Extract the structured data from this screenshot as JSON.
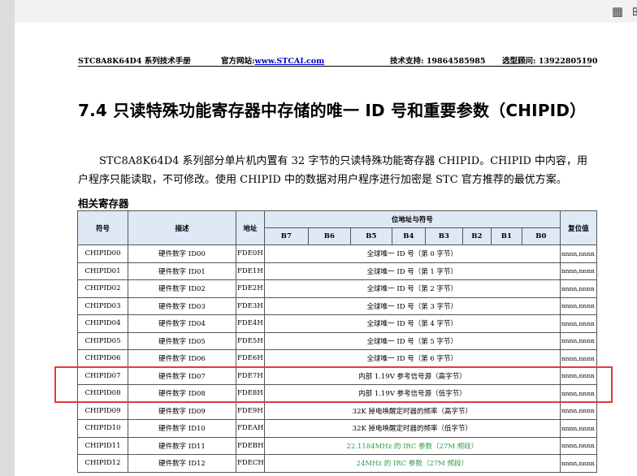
{
  "header": {
    "doc_name": "STC8A8K64D4 系列技术手册",
    "site_label": "官方网站:",
    "site_url": "www.STCAI.com",
    "support": "技术支持: 19864585985",
    "advisor": "选型顾问: 13922805190"
  },
  "section_title": "7.4   只读特殊功能寄存器中存储的唯一 ID 号和重要参数（CHIPID）",
  "paragraph": {
    "line1": "STC8A8K64D4 系列部分单片机内置有 32 字节的只读特殊功能寄存器 CHIPID。CHIPID 中内容，用",
    "line2": "户程序只能读取，不可修改。使用 CHIPID 中的数据对用户程序进行加密是 STC 官方推荐的最优方案。"
  },
  "subheading": "相关寄存器",
  "table": {
    "headers": {
      "symbol": "符号",
      "desc": "描述",
      "addr": "地址",
      "bits_group": "位地址与符号",
      "reset": "复位值",
      "bits": [
        "B7",
        "B6",
        "B5",
        "B4",
        "B3",
        "B2",
        "B1",
        "B0"
      ]
    },
    "rows": [
      {
        "sym": "CHIPID00",
        "desc": "硬件数字 ID00",
        "addr": "FDE0H",
        "content": "全球唯一 ID 号（第 0 字节）",
        "reset": "nnnn,nnnn"
      },
      {
        "sym": "CHIPID01",
        "desc": "硬件数字 ID01",
        "addr": "FDE1H",
        "content": "全球唯一 ID 号（第 1 字节）",
        "reset": "nnnn,nnnn"
      },
      {
        "sym": "CHIPID02",
        "desc": "硬件数字 ID02",
        "addr": "FDE2H",
        "content": "全球唯一 ID 号（第 2 字节）",
        "reset": "nnnn,nnnn"
      },
      {
        "sym": "CHIPID03",
        "desc": "硬件数字 ID03",
        "addr": "FDE3H",
        "content": "全球唯一 ID 号（第 3 字节）",
        "reset": "nnnn,nnnn"
      },
      {
        "sym": "CHIPID04",
        "desc": "硬件数字 ID04",
        "addr": "FDE4H",
        "content": "全球唯一 ID 号（第 4 字节）",
        "reset": "nnnn,nnnn"
      },
      {
        "sym": "CHIPID05",
        "desc": "硬件数字 ID05",
        "addr": "FDE5H",
        "content": "全球唯一 ID 号（第 5 字节）",
        "reset": "nnnn,nnnn"
      },
      {
        "sym": "CHIPID06",
        "desc": "硬件数字 ID06",
        "addr": "FDE6H",
        "content": "全球唯一 ID 号（第 6 字节）",
        "reset": "nnnn,nnnn"
      },
      {
        "sym": "CHIPID07",
        "desc": "硬件数字 ID07",
        "addr": "FDE7H",
        "content": "内部 1.19V 参考信号源（高字节）",
        "reset": "nnnn,nnnn"
      },
      {
        "sym": "CHIPID08",
        "desc": "硬件数字 ID08",
        "addr": "FDE8H",
        "content": "内部 1.19V 参考信号源（低字节）",
        "reset": "nnnn,nnnn"
      },
      {
        "sym": "CHIPID09",
        "desc": "硬件数字 ID09",
        "addr": "FDE9H",
        "content": "32K 掉电唤醒定时器的频率（高字节）",
        "reset": "nnnn,nnnn"
      },
      {
        "sym": "CHIPID10",
        "desc": "硬件数字 ID10",
        "addr": "FDEAH",
        "content": "32K 掉电唤醒定时器的频率（低字节）",
        "reset": "nnnn,nnnn"
      },
      {
        "sym": "CHIPID11",
        "desc": "硬件数字 ID11",
        "addr": "FDEBH",
        "content": "22.1184MHz 的 IRC 参数（27M 频段）",
        "reset": "nnnn,nnnn"
      },
      {
        "sym": "CHIPID12",
        "desc": "硬件数字 ID12",
        "addr": "FDECH",
        "content": "24MHz 的 IRC 参数（27M 频段）",
        "reset": "nnnn,nnnn"
      }
    ]
  },
  "colors": {
    "highlight_box": "#e23a3a",
    "table_header_bg": "#dfe8f5",
    "irc_text": "#2e9d4a",
    "link": "#0000cc"
  },
  "toolbar_icons": [
    "grid-icon",
    "apps-icon"
  ]
}
